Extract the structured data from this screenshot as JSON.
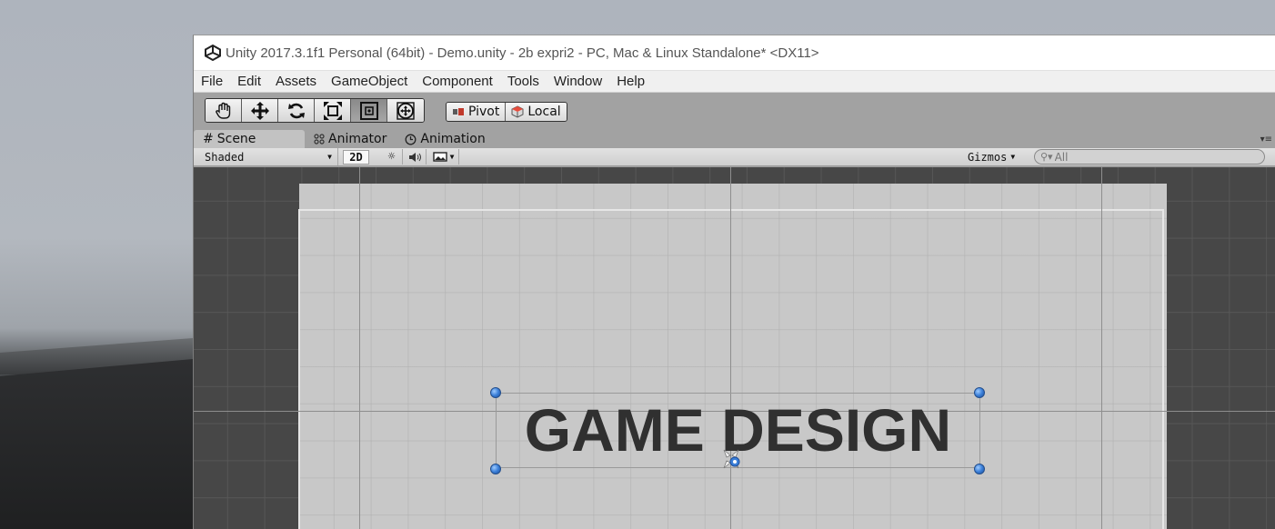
{
  "window": {
    "title": "Unity 2017.3.1f1 Personal (64bit) - Demo.unity - 2b expri2 - PC, Mac & Linux Standalone* <DX11>"
  },
  "menu": [
    "File",
    "Edit",
    "Assets",
    "GameObject",
    "Component",
    "Tools",
    "Window",
    "Help"
  ],
  "toolbar": {
    "tools": [
      {
        "name": "hand-tool",
        "icon": "hand-icon"
      },
      {
        "name": "move-tool",
        "icon": "move-arrows-icon"
      },
      {
        "name": "rotate-tool",
        "icon": "rotate-icon"
      },
      {
        "name": "scale-tool",
        "icon": "scale-icon"
      },
      {
        "name": "rect-tool",
        "icon": "rect-icon",
        "active": true
      },
      {
        "name": "transform-tool",
        "icon": "transform-icon"
      }
    ],
    "pivot_label": "Pivot",
    "local_label": "Local"
  },
  "tabs": {
    "scene": "Scene",
    "animator": "Animator",
    "animation": "Animation"
  },
  "scenebar": {
    "shading_mode": "Shaded",
    "mode_2d": "2D",
    "gizmos_label": "Gizmos",
    "search_placeholder": "All"
  },
  "scene": {
    "ui_text": "GAME DESIGN"
  },
  "colors": {
    "handle_blue": "#3b7fd8",
    "editor_gray": "#a2a2a2",
    "canvas_gray": "#c8c8c8",
    "text_dark": "#303030"
  }
}
